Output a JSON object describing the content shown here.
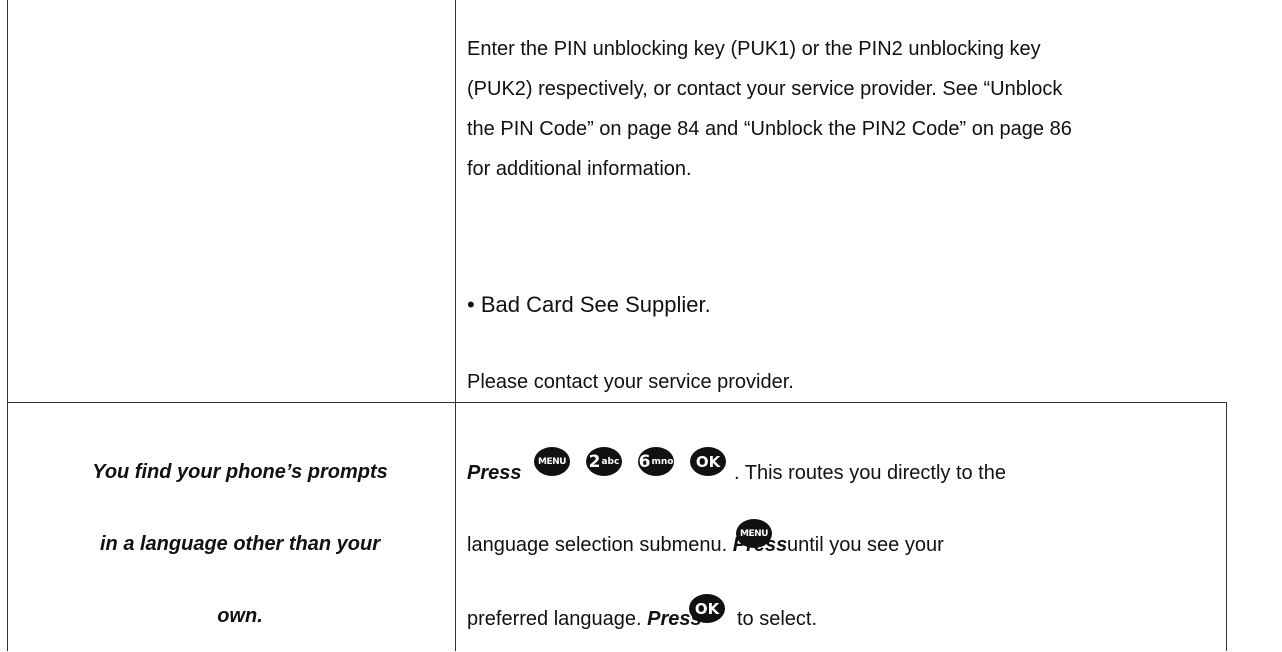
{
  "row1": {
    "puk_paragraph": [
      "Enter the PIN unblocking key (PUK1) or the PIN2 unblocking key",
      "(PUK2) respectively, or contact your service provider. See “Unblock",
      "the PIN Code” on page 84 and “Unblock the PIN2 Code” on page 86",
      "for additional information."
    ],
    "bullet_item": "• Bad Card See Supplier.",
    "contact_text": "Please contact your service provider."
  },
  "row2": {
    "problem_lines": [
      "You find your phone’s prompts",
      "in a language other than your",
      "own."
    ],
    "solution": {
      "press_label": "Press",
      "line1_after": ". This routes you directly to the",
      "line2_before": "language selection submenu.",
      "line2_after": "until you see your",
      "line3_before": "preferred language.",
      "line3_after": "to select."
    },
    "keys": {
      "menu": "MENU",
      "two_digit": "2",
      "two_letters": "abc",
      "six_digit": "6",
      "six_letters": "mno",
      "ok": "OK"
    }
  }
}
